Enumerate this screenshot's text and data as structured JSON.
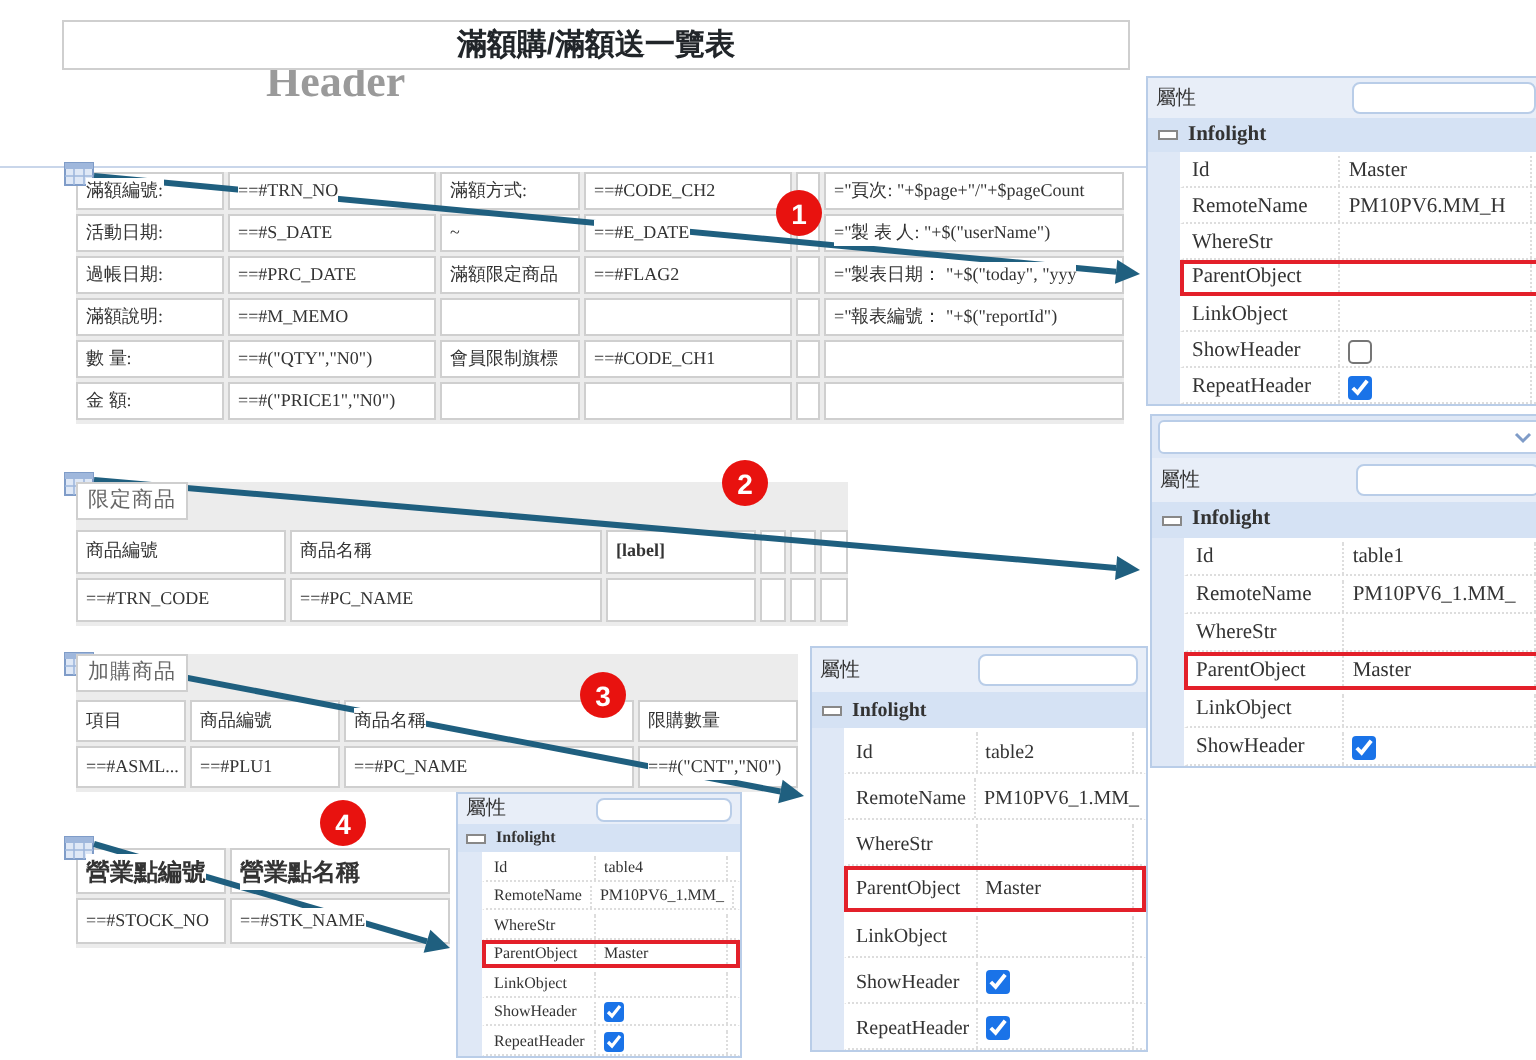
{
  "title": "滿額購/滿額送一覽表",
  "band_label": "Header",
  "tables": [
    {
      "rows": [
        {
          "cells": [
            "滿額編號:",
            "==#TRN_NO",
            "滿額方式:",
            "==#CODE_CH2",
            null,
            "=\"頁次: \"+$page+\"/\"+$pageCount"
          ]
        },
        {
          "cells": [
            "活動日期:",
            "==#S_DATE",
            "~",
            "==#E_DATE",
            null,
            "=\"製 表 人: \"+$(\"userName\")"
          ]
        },
        {
          "cells": [
            "過帳日期:",
            "==#PRC_DATE",
            "滿額限定商品",
            "==#FLAG2",
            null,
            "=\"製表日期： \"+$(\"today\", \"yyy"
          ]
        },
        {
          "cells": [
            "滿額說明:",
            "==#M_MEMO",
            null,
            null,
            null,
            "=\"報表編號： \"+$(\"reportId\")"
          ]
        },
        {
          "cells": [
            "數 量:",
            "==#(\"QTY\",\"N0\")",
            "會員限制旗標",
            "==#CODE_CH1",
            null,
            null
          ]
        },
        {
          "cells": [
            "金 額:",
            "==#(\"PRICE1\",\"N0\")",
            null,
            null,
            null,
            null
          ]
        }
      ]
    },
    {
      "caption": "限定商品",
      "rows": [
        {
          "cells": [
            "商品編號",
            "商品名稱",
            "[label]",
            null,
            null,
            null
          ]
        },
        {
          "cells": [
            "==#TRN_CODE",
            "==#PC_NAME",
            null,
            null,
            null,
            null
          ]
        }
      ]
    },
    {
      "caption": "加購商品",
      "rows": [
        {
          "cells": [
            "項目",
            "商品編號",
            "商品名稱",
            "限購數量"
          ]
        },
        {
          "cells": [
            "==#ASML...",
            "==#PLU1",
            "==#PC_NAME",
            "==#(\"CNT\",\"N0\")"
          ]
        }
      ]
    },
    {
      "rows": [
        {
          "emphasis": true,
          "cells": [
            "營業點編號",
            "營業點名稱"
          ]
        },
        {
          "cells": [
            "==#STOCK_NO",
            "==#STK_NAME"
          ]
        }
      ]
    }
  ],
  "panels": [
    {
      "title": "屬性",
      "group": "Infolight",
      "properties": [
        {
          "name": "Id",
          "kind": "text",
          "value": "Master",
          "highlighted": false
        },
        {
          "name": "RemoteName",
          "kind": "text",
          "value": "PM10PV6.MM_H",
          "highlighted": false
        },
        {
          "name": "WhereStr",
          "kind": "text",
          "highlighted": false
        },
        {
          "name": "ParentObject",
          "kind": "text",
          "highlighted": true
        },
        {
          "name": "LinkObject",
          "kind": "text",
          "highlighted": false
        },
        {
          "name": "ShowHeader",
          "kind": "checkbox",
          "checked": false,
          "highlighted": false
        },
        {
          "name": "RepeatHeader",
          "kind": "checkbox",
          "checked": true,
          "highlighted": false
        }
      ]
    },
    {
      "dropdown": true,
      "title": "屬性",
      "group": "Infolight",
      "properties": [
        {
          "name": "Id",
          "kind": "text",
          "value": "table1",
          "highlighted": false
        },
        {
          "name": "RemoteName",
          "kind": "text",
          "value": "PM10PV6_1.MM_",
          "highlighted": false
        },
        {
          "name": "WhereStr",
          "kind": "text",
          "highlighted": false
        },
        {
          "name": "ParentObject",
          "kind": "text",
          "value": "Master",
          "highlighted": true
        },
        {
          "name": "LinkObject",
          "kind": "text",
          "highlighted": false
        },
        {
          "name": "ShowHeader",
          "kind": "checkbox",
          "checked": true,
          "highlighted": false
        }
      ]
    },
    {
      "title": "屬性",
      "group": "Infolight",
      "properties": [
        {
          "name": "Id",
          "kind": "text",
          "value": "table2",
          "highlighted": false
        },
        {
          "name": "RemoteName",
          "kind": "text",
          "value": "PM10PV6_1.MM_",
          "highlighted": false
        },
        {
          "name": "WhereStr",
          "kind": "text",
          "highlighted": false
        },
        {
          "name": "ParentObject",
          "kind": "text",
          "value": "Master",
          "highlighted": true
        },
        {
          "name": "LinkObject",
          "kind": "text",
          "highlighted": false
        },
        {
          "name": "ShowHeader",
          "kind": "checkbox",
          "checked": true,
          "highlighted": false
        },
        {
          "name": "RepeatHeader",
          "kind": "checkbox",
          "checked": true,
          "highlighted": false
        }
      ]
    },
    {
      "title": "屬性",
      "group": "Infolight",
      "properties": [
        {
          "name": "Id",
          "kind": "text",
          "value": "table4",
          "highlighted": false
        },
        {
          "name": "RemoteName",
          "kind": "text",
          "value": "PM10PV6_1.MM_",
          "highlighted": false
        },
        {
          "name": "WhereStr",
          "kind": "text",
          "highlighted": false
        },
        {
          "name": "ParentObject",
          "kind": "text",
          "value": "Master",
          "highlighted": true
        },
        {
          "name": "LinkObject",
          "kind": "text",
          "highlighted": false
        },
        {
          "name": "ShowHeader",
          "kind": "checkbox",
          "checked": true,
          "highlighted": false
        },
        {
          "name": "RepeatHeader",
          "kind": "checkbox",
          "checked": true,
          "highlighted": false
        }
      ]
    }
  ],
  "callouts": [
    "1",
    "2",
    "3",
    "4"
  ]
}
